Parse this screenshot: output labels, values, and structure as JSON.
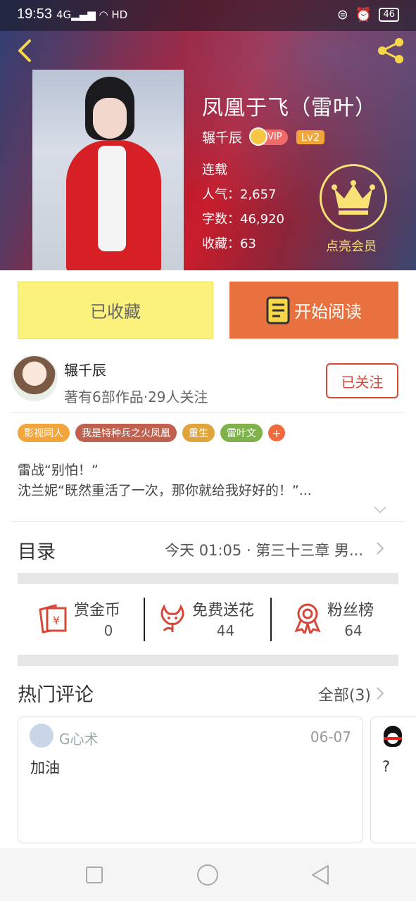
{
  "status_bar": {
    "time": "19:53",
    "signal": "4G",
    "network_hd": "HD",
    "battery": "46"
  },
  "book": {
    "title": "凤凰于飞（雷叶）",
    "author": "辗千辰",
    "vip_label": "VIP",
    "level": "Lv2",
    "status": "连载",
    "popularity": "人气：2,657",
    "word_count": "字数：46,920",
    "favorites": "收藏：63",
    "vip_member_label": "点亮会员"
  },
  "actions": {
    "collected_label": "已收藏",
    "read_label": "开始阅读"
  },
  "author_info": {
    "name": "辗千辰",
    "stats": "著有6部作品·29人关注",
    "follow_label": "已关注"
  },
  "tags": [
    {
      "label": "影视同人",
      "color": "#f1a53b"
    },
    {
      "label": "我是特种兵之火凤凰",
      "color": "#c0614f"
    },
    {
      "label": "重生",
      "color": "#e0a53a"
    },
    {
      "label": "雷叶文",
      "color": "#7fb24a"
    }
  ],
  "tag_more": "+",
  "summary": {
    "line1": "雷战“别怕！”",
    "line2": "沈兰妮“既然重活了一次，那你就给我好好的！”..."
  },
  "toc": {
    "title": "目录",
    "latest": "今天 01:05 · 第三十三章 男..."
  },
  "stats": {
    "reward": {
      "label": "赏金币",
      "value": "0"
    },
    "flowers": {
      "label": "免费送花",
      "value": "44"
    },
    "fans": {
      "label": "粉丝榜",
      "value": "64"
    }
  },
  "comments": {
    "title": "热门评论",
    "all_label": "全部(3)",
    "items": [
      {
        "user": "G心术",
        "date": "06-07",
        "text": "加油"
      },
      {
        "user": "",
        "date": "",
        "text": "?"
      }
    ]
  },
  "colors": {
    "accent_orange": "#e9703f",
    "collected_yellow": "#fbf17d",
    "follow_red": "#d7483a",
    "vip_gold": "#f9e275"
  }
}
